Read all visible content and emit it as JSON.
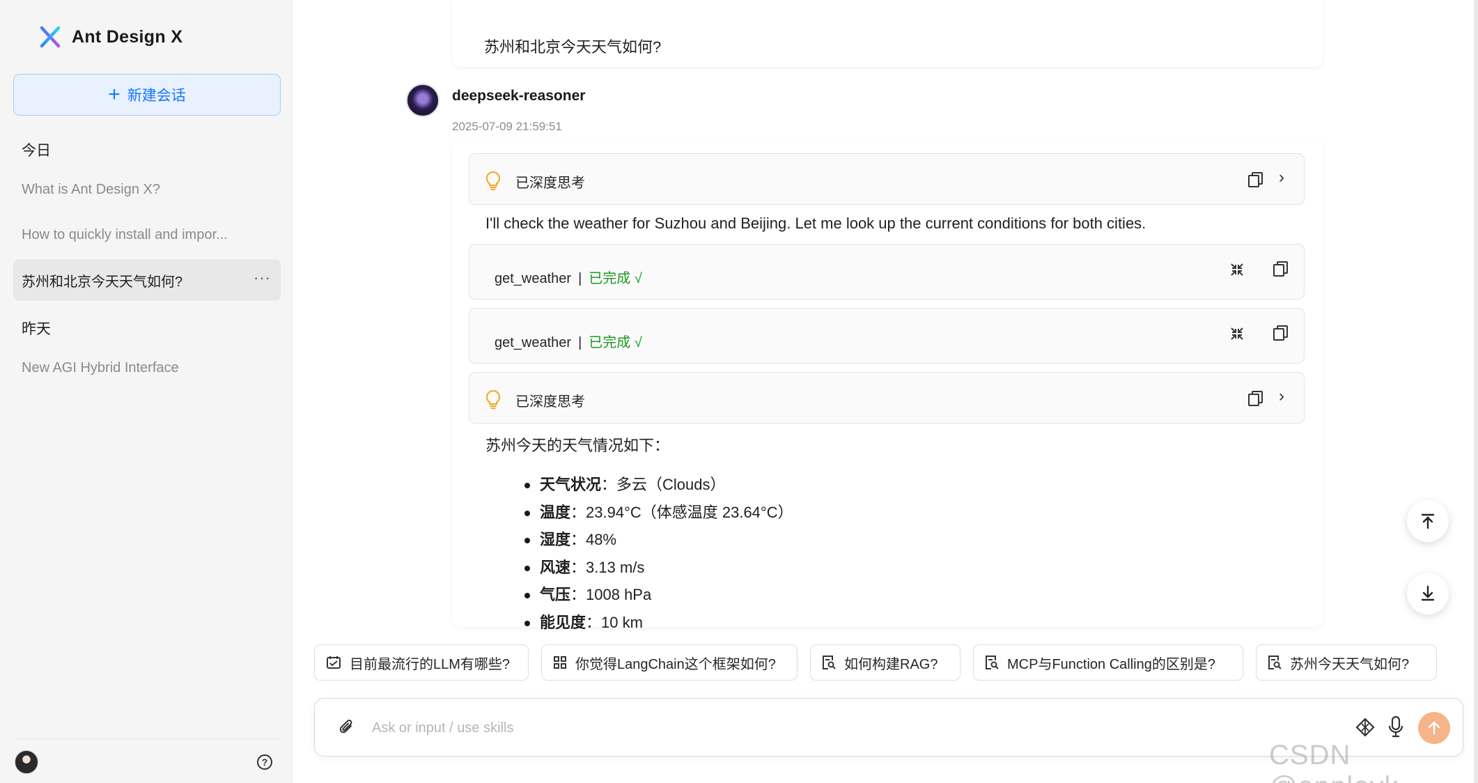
{
  "brand": {
    "name": "Ant Design X"
  },
  "sidebar": {
    "new_chat_label": "新建会话",
    "groups": [
      {
        "title": "今日"
      },
      {
        "title": "昨天"
      }
    ],
    "items": [
      {
        "label": "What is Ant Design X?"
      },
      {
        "label": "How to quickly install and impor..."
      },
      {
        "label": "苏州和北京今天天气如何?",
        "active": true,
        "more": "···"
      },
      {
        "label": "New AGI Hybrid Interface"
      }
    ],
    "help": "?"
  },
  "chat": {
    "user_message": "苏州和北京今天天气如何?",
    "bot": {
      "name": "deepseek-reasoner",
      "time": "2025-07-09 21:59:51",
      "think1_label": "已深度思考",
      "intro": "I'll check the weather for Suzhou and Beijing. Let me look up the current conditions for both cities.",
      "tools": [
        {
          "name": "get_weather",
          "sep": "|",
          "status": "已完成 √"
        },
        {
          "name": "get_weather",
          "sep": "|",
          "status": "已完成 √"
        }
      ],
      "think2_label": "已深度思考",
      "answer_intro": "苏州今天的天气情况如下：",
      "details": [
        {
          "key": "天气状况",
          "value": "：多云（Clouds）"
        },
        {
          "key": "温度",
          "value": "：23.94°C（体感温度 23.64°C）"
        },
        {
          "key": "湿度",
          "value": "：48%"
        },
        {
          "key": "风速",
          "value": "：3.13 m/s"
        },
        {
          "key": "气压",
          "value": "：1008 hPa"
        },
        {
          "key": "能见度",
          "value": "：10 km"
        }
      ]
    }
  },
  "prompts": [
    {
      "label": "目前最流行的LLM有哪些?",
      "icon": "calendar-icon"
    },
    {
      "label": "你觉得LangChain这个框架如何?",
      "icon": "grid-icon"
    },
    {
      "label": "如何构建RAG?",
      "icon": "file-search-icon"
    },
    {
      "label": "MCP与Function Calling的区别是?",
      "icon": "file-search-icon"
    },
    {
      "label": "苏州今天天气如何?",
      "icon": "file-search-icon"
    }
  ],
  "sender": {
    "placeholder": "Ask or input / use skills"
  },
  "watermark": "CSDN @appleyk",
  "colors": {
    "accent": "#1677ff",
    "success": "#1e9a1e",
    "think": "#f5a623",
    "send": "#f5b48a"
  }
}
